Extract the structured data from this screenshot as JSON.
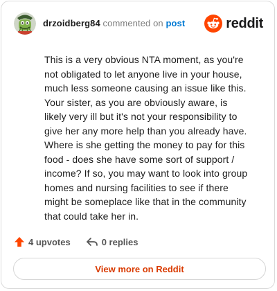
{
  "header": {
    "username": "drzoidberg84",
    "action_text": "commented on",
    "post_link": "post",
    "brand_name": "reddit"
  },
  "comment": {
    "body": "This is a very obvious NTA moment, as you're not obligated to let anyone live in your house, much less someone causing an issue like this. Your sister, as you are obviously aware, is likely very ill but it's not your responsibility to give her any more help than you already have. Where is she getting the money to pay for this food - does she have some sort of support / income? If so, you may want to look into group homes and nursing facilities to see if there might be someplace like that in the community that could take her in."
  },
  "stats": {
    "upvotes": "4 upvotes",
    "replies": "0 replies"
  },
  "footer": {
    "view_more": "View more on Reddit"
  },
  "colors": {
    "brand_orange": "#ff4500",
    "upvote_orange": "#ff4500",
    "link_blue": "#0079d3",
    "cta_text": "#d93a00"
  },
  "icons": {
    "avatar": "snoo-avatar-icon",
    "brand": "reddit-logo-icon",
    "upvote": "upvote-arrow-icon",
    "reply": "reply-arrow-icon"
  }
}
